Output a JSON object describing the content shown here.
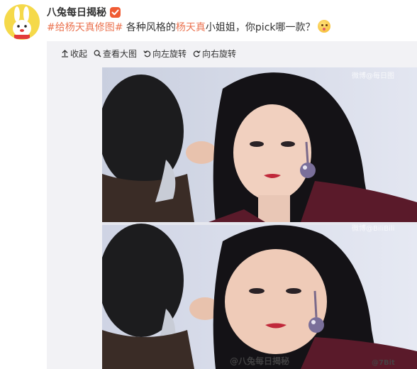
{
  "user": {
    "name": "八兔每日揭秘"
  },
  "post": {
    "hashtag": "#给杨天真修图#",
    "text_before": " 各种风格的",
    "highlight": "杨天真",
    "text_after": "小姐姐，你pick哪一款？"
  },
  "toolbar": {
    "collapse_label": "收起",
    "view_large_label": "查看大图",
    "rotate_left_label": "向左旋转",
    "rotate_right_label": "向右旋转"
  },
  "image": {
    "watermark_top": "微博@每日图",
    "watermark_mid": "微博@BiliBili",
    "watermark_main": "@八兔每日揭秘",
    "watermark_corner": "@7Bit"
  },
  "colors": {
    "accent": "#eb7350",
    "badge": "#f05b33",
    "avatar_bg": "#f5d94a"
  }
}
